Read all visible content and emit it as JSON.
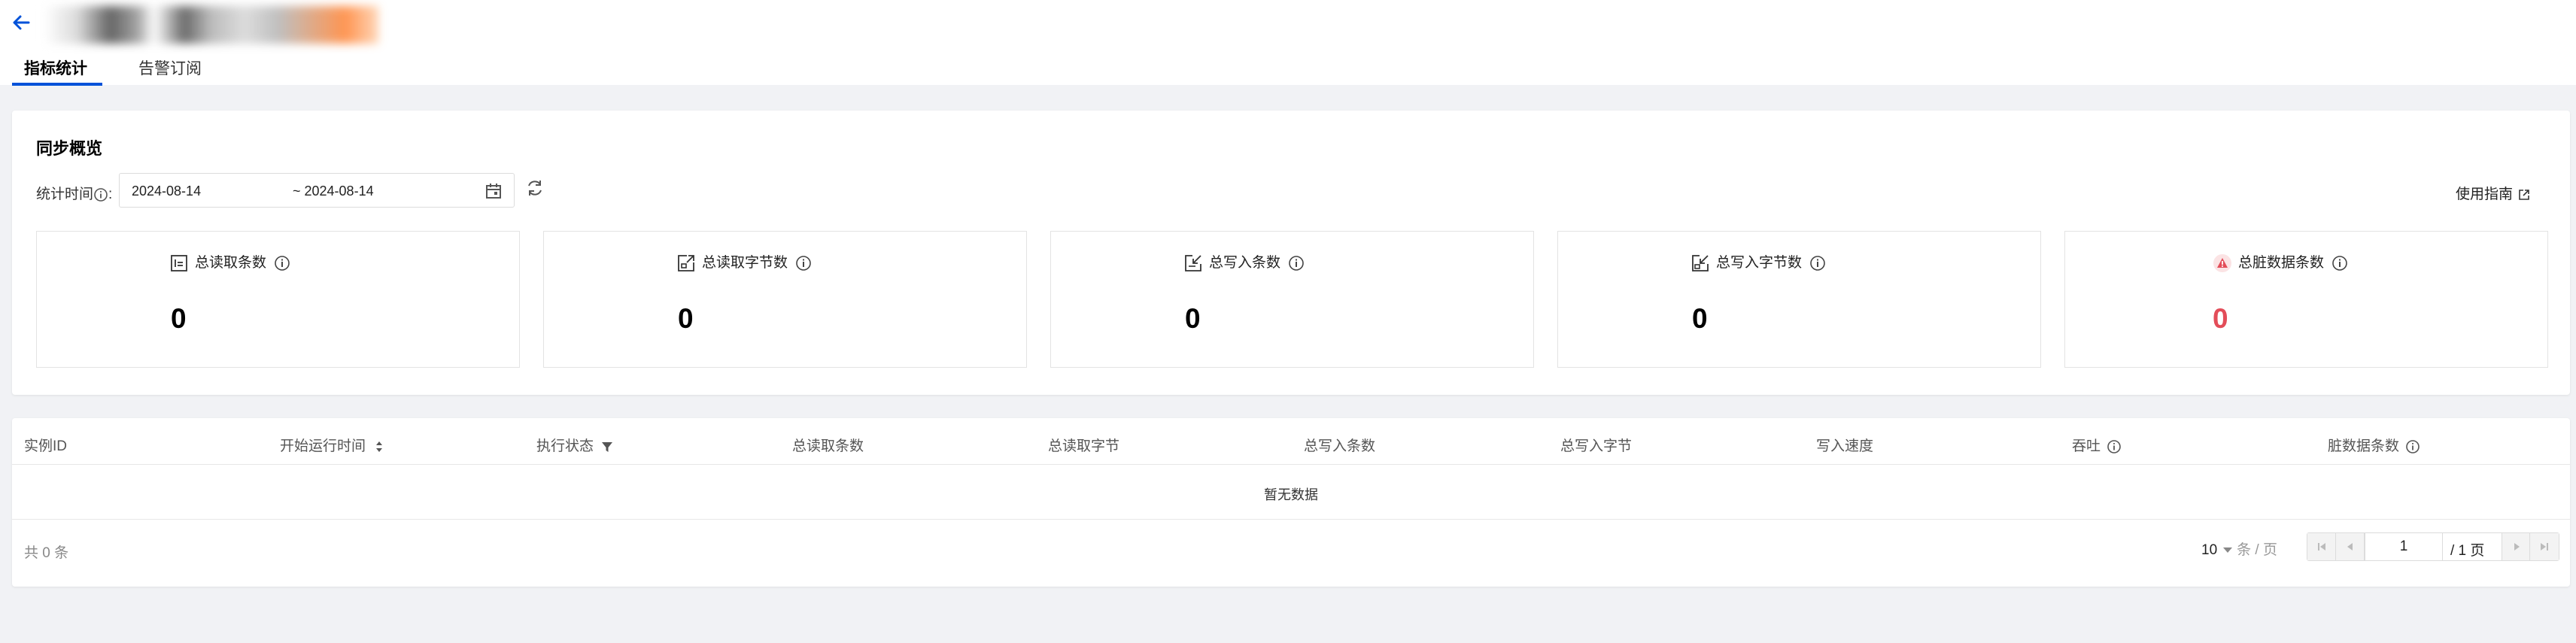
{
  "header": {
    "tabs": [
      {
        "label": "指标统计",
        "active": true
      },
      {
        "label": "告警订阅",
        "active": false
      }
    ],
    "accent_color": "#0052d9"
  },
  "overview": {
    "title": "同步概览",
    "date_label": "统计时间",
    "date_colon": ":",
    "date_start": "2024-08-14",
    "date_end": "~ 2024-08-14",
    "guide_label": "使用指南",
    "stats": [
      {
        "label": "总读取条数",
        "value": "0",
        "icon": "read-rows-icon"
      },
      {
        "label": "总读取字节数",
        "value": "0",
        "icon": "read-bytes-icon"
      },
      {
        "label": "总写入条数",
        "value": "0",
        "icon": "write-rows-icon"
      },
      {
        "label": "总写入字节数",
        "value": "0",
        "icon": "write-bytes-icon"
      },
      {
        "label": "总脏数据条数",
        "value": "0",
        "icon": "dirty-data-icon",
        "value_color": "#e34d59"
      }
    ]
  },
  "table": {
    "columns": [
      "实例ID",
      "开始运行时间",
      "执行状态",
      "总读取条数",
      "总读取字节",
      "总写入条数",
      "总写入字节",
      "写入速度",
      "吞吐",
      "脏数据条数"
    ],
    "empty_text": "暂无数据",
    "total_text": "共 0 条",
    "page_size": "10",
    "page_size_unit": "条 / 页",
    "current_page": "1",
    "page_total": "/ 1 页"
  }
}
